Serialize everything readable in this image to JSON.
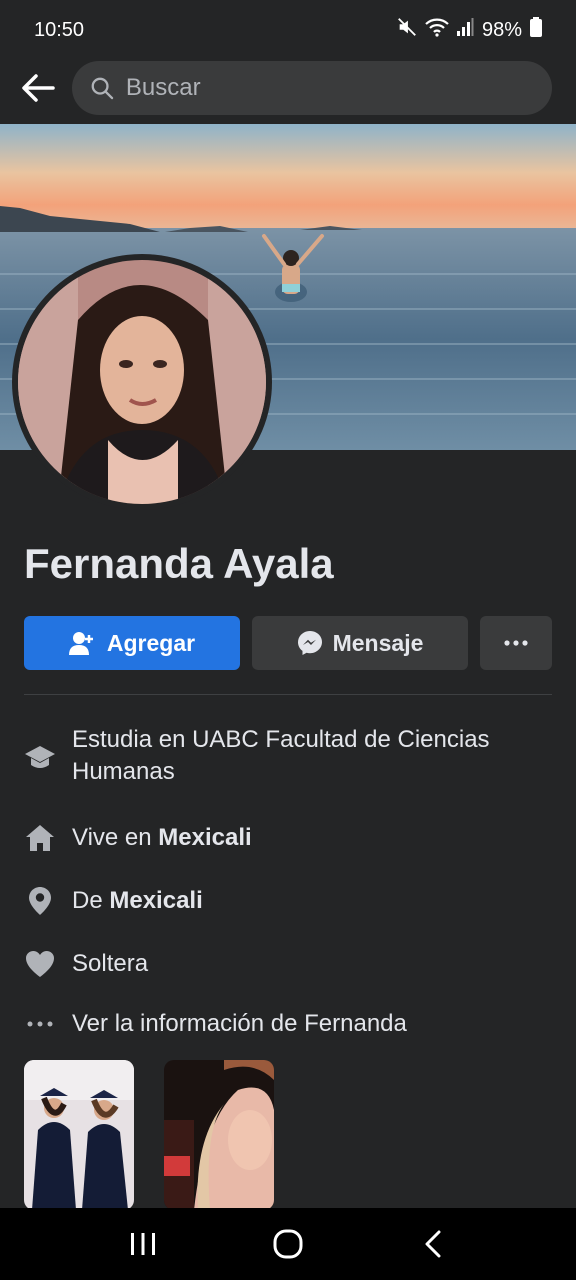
{
  "status_bar": {
    "time": "10:50",
    "battery": "98%",
    "icons": [
      "mute-icon",
      "wifi-icon",
      "signal-icon",
      "battery-icon"
    ]
  },
  "header": {
    "back_icon": "arrow-left-icon",
    "search_placeholder": "Buscar"
  },
  "profile": {
    "name": "Fernanda Ayala"
  },
  "actions": {
    "add_label": "Agregar",
    "message_label": "Mensaje",
    "more_icon": "ellipsis-icon"
  },
  "info": {
    "education": "Estudia en UABC Facultad de Ciencias Humanas",
    "lives_prefix": "Vive en ",
    "lives_city": "Mexicali",
    "from_prefix": "De ",
    "from_city": "Mexicali",
    "relationship": "Soltera",
    "see_more": "Ver la información de Fernanda"
  },
  "colors": {
    "background": "#242526",
    "primary": "#2374e1",
    "secondary": "#3a3b3c"
  }
}
